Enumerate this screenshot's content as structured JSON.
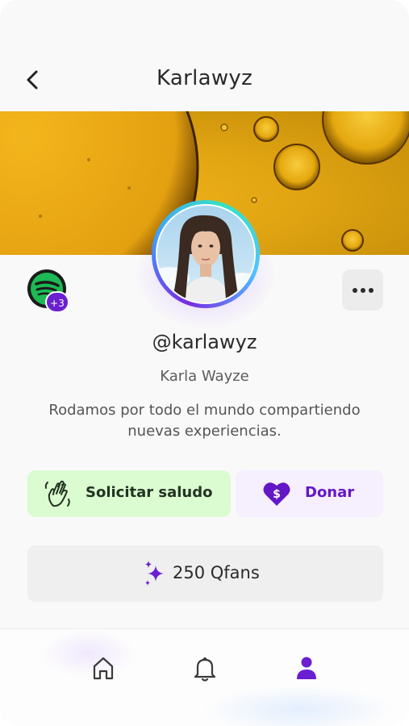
{
  "header": {
    "title": "Karlawyz"
  },
  "profile": {
    "username": "@karlawyz",
    "full_name": "Karla Wayze",
    "bio": "Rodamos por todo el mundo compartiendo nuevas experiencias.",
    "spotify_badge": "+3"
  },
  "actions": {
    "request_greeting_label": "Solicitar saludo",
    "donate_label": "Donar",
    "qfans_label": "250 Qfans"
  },
  "nav": {
    "items": [
      "home-icon",
      "bell-icon",
      "profile-icon"
    ],
    "active": "profile-icon"
  },
  "colors": {
    "accent": "#6a1fd0",
    "greeting_bg": "#dbfcd1",
    "donate_bg": "#f5effe",
    "spotify_green": "#1db954"
  }
}
